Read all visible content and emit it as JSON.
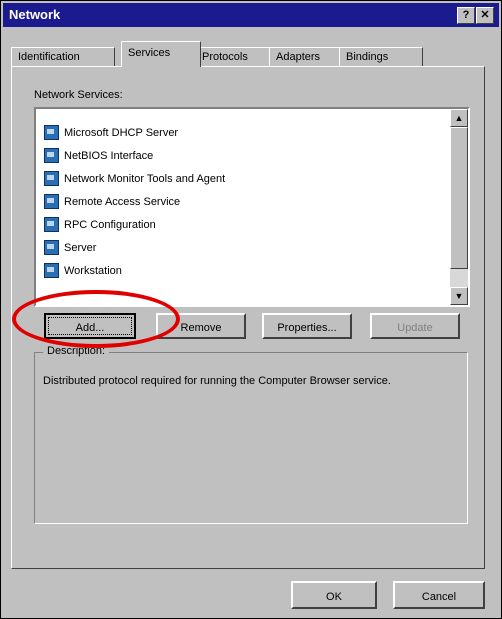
{
  "window": {
    "title": "Network",
    "help_label": "?",
    "close_label": "✕"
  },
  "tabs": [
    {
      "label": "Identification"
    },
    {
      "label": "Services"
    },
    {
      "label": "Protocols"
    },
    {
      "label": "Adapters"
    },
    {
      "label": "Bindings"
    }
  ],
  "services": {
    "label": "Network Services:",
    "items": [
      "Microsoft DHCP Server",
      "NetBIOS Interface",
      "Network Monitor Tools and Agent",
      "Remote Access Service",
      "RPC Configuration",
      "Server",
      "Workstation"
    ]
  },
  "buttons": {
    "add": "Add...",
    "remove": "Remove",
    "properties": "Properties...",
    "update": "Update",
    "ok": "OK",
    "cancel": "Cancel"
  },
  "description": {
    "label": "Description:",
    "text": "Distributed protocol required for running the Computer Browser service."
  },
  "annotation": {
    "color": "#e10000"
  }
}
